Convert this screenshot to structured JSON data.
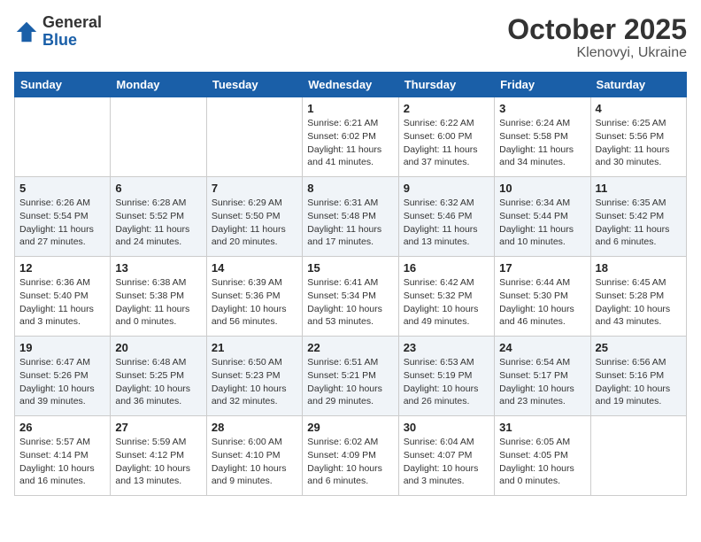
{
  "header": {
    "logo": {
      "general": "General",
      "blue": "Blue"
    },
    "month": "October 2025",
    "location": "Klenovyi, Ukraine"
  },
  "weekdays": [
    "Sunday",
    "Monday",
    "Tuesday",
    "Wednesday",
    "Thursday",
    "Friday",
    "Saturday"
  ],
  "weeks": [
    [
      {
        "day": "",
        "info": ""
      },
      {
        "day": "",
        "info": ""
      },
      {
        "day": "",
        "info": ""
      },
      {
        "day": "1",
        "info": "Sunrise: 6:21 AM\nSunset: 6:02 PM\nDaylight: 11 hours\nand 41 minutes."
      },
      {
        "day": "2",
        "info": "Sunrise: 6:22 AM\nSunset: 6:00 PM\nDaylight: 11 hours\nand 37 minutes."
      },
      {
        "day": "3",
        "info": "Sunrise: 6:24 AM\nSunset: 5:58 PM\nDaylight: 11 hours\nand 34 minutes."
      },
      {
        "day": "4",
        "info": "Sunrise: 6:25 AM\nSunset: 5:56 PM\nDaylight: 11 hours\nand 30 minutes."
      }
    ],
    [
      {
        "day": "5",
        "info": "Sunrise: 6:26 AM\nSunset: 5:54 PM\nDaylight: 11 hours\nand 27 minutes."
      },
      {
        "day": "6",
        "info": "Sunrise: 6:28 AM\nSunset: 5:52 PM\nDaylight: 11 hours\nand 24 minutes."
      },
      {
        "day": "7",
        "info": "Sunrise: 6:29 AM\nSunset: 5:50 PM\nDaylight: 11 hours\nand 20 minutes."
      },
      {
        "day": "8",
        "info": "Sunrise: 6:31 AM\nSunset: 5:48 PM\nDaylight: 11 hours\nand 17 minutes."
      },
      {
        "day": "9",
        "info": "Sunrise: 6:32 AM\nSunset: 5:46 PM\nDaylight: 11 hours\nand 13 minutes."
      },
      {
        "day": "10",
        "info": "Sunrise: 6:34 AM\nSunset: 5:44 PM\nDaylight: 11 hours\nand 10 minutes."
      },
      {
        "day": "11",
        "info": "Sunrise: 6:35 AM\nSunset: 5:42 PM\nDaylight: 11 hours\nand 6 minutes."
      }
    ],
    [
      {
        "day": "12",
        "info": "Sunrise: 6:36 AM\nSunset: 5:40 PM\nDaylight: 11 hours\nand 3 minutes."
      },
      {
        "day": "13",
        "info": "Sunrise: 6:38 AM\nSunset: 5:38 PM\nDaylight: 11 hours\nand 0 minutes."
      },
      {
        "day": "14",
        "info": "Sunrise: 6:39 AM\nSunset: 5:36 PM\nDaylight: 10 hours\nand 56 minutes."
      },
      {
        "day": "15",
        "info": "Sunrise: 6:41 AM\nSunset: 5:34 PM\nDaylight: 10 hours\nand 53 minutes."
      },
      {
        "day": "16",
        "info": "Sunrise: 6:42 AM\nSunset: 5:32 PM\nDaylight: 10 hours\nand 49 minutes."
      },
      {
        "day": "17",
        "info": "Sunrise: 6:44 AM\nSunset: 5:30 PM\nDaylight: 10 hours\nand 46 minutes."
      },
      {
        "day": "18",
        "info": "Sunrise: 6:45 AM\nSunset: 5:28 PM\nDaylight: 10 hours\nand 43 minutes."
      }
    ],
    [
      {
        "day": "19",
        "info": "Sunrise: 6:47 AM\nSunset: 5:26 PM\nDaylight: 10 hours\nand 39 minutes."
      },
      {
        "day": "20",
        "info": "Sunrise: 6:48 AM\nSunset: 5:25 PM\nDaylight: 10 hours\nand 36 minutes."
      },
      {
        "day": "21",
        "info": "Sunrise: 6:50 AM\nSunset: 5:23 PM\nDaylight: 10 hours\nand 32 minutes."
      },
      {
        "day": "22",
        "info": "Sunrise: 6:51 AM\nSunset: 5:21 PM\nDaylight: 10 hours\nand 29 minutes."
      },
      {
        "day": "23",
        "info": "Sunrise: 6:53 AM\nSunset: 5:19 PM\nDaylight: 10 hours\nand 26 minutes."
      },
      {
        "day": "24",
        "info": "Sunrise: 6:54 AM\nSunset: 5:17 PM\nDaylight: 10 hours\nand 23 minutes."
      },
      {
        "day": "25",
        "info": "Sunrise: 6:56 AM\nSunset: 5:16 PM\nDaylight: 10 hours\nand 19 minutes."
      }
    ],
    [
      {
        "day": "26",
        "info": "Sunrise: 5:57 AM\nSunset: 4:14 PM\nDaylight: 10 hours\nand 16 minutes."
      },
      {
        "day": "27",
        "info": "Sunrise: 5:59 AM\nSunset: 4:12 PM\nDaylight: 10 hours\nand 13 minutes."
      },
      {
        "day": "28",
        "info": "Sunrise: 6:00 AM\nSunset: 4:10 PM\nDaylight: 10 hours\nand 9 minutes."
      },
      {
        "day": "29",
        "info": "Sunrise: 6:02 AM\nSunset: 4:09 PM\nDaylight: 10 hours\nand 6 minutes."
      },
      {
        "day": "30",
        "info": "Sunrise: 6:04 AM\nSunset: 4:07 PM\nDaylight: 10 hours\nand 3 minutes."
      },
      {
        "day": "31",
        "info": "Sunrise: 6:05 AM\nSunset: 4:05 PM\nDaylight: 10 hours\nand 0 minutes."
      },
      {
        "day": "",
        "info": ""
      }
    ]
  ]
}
